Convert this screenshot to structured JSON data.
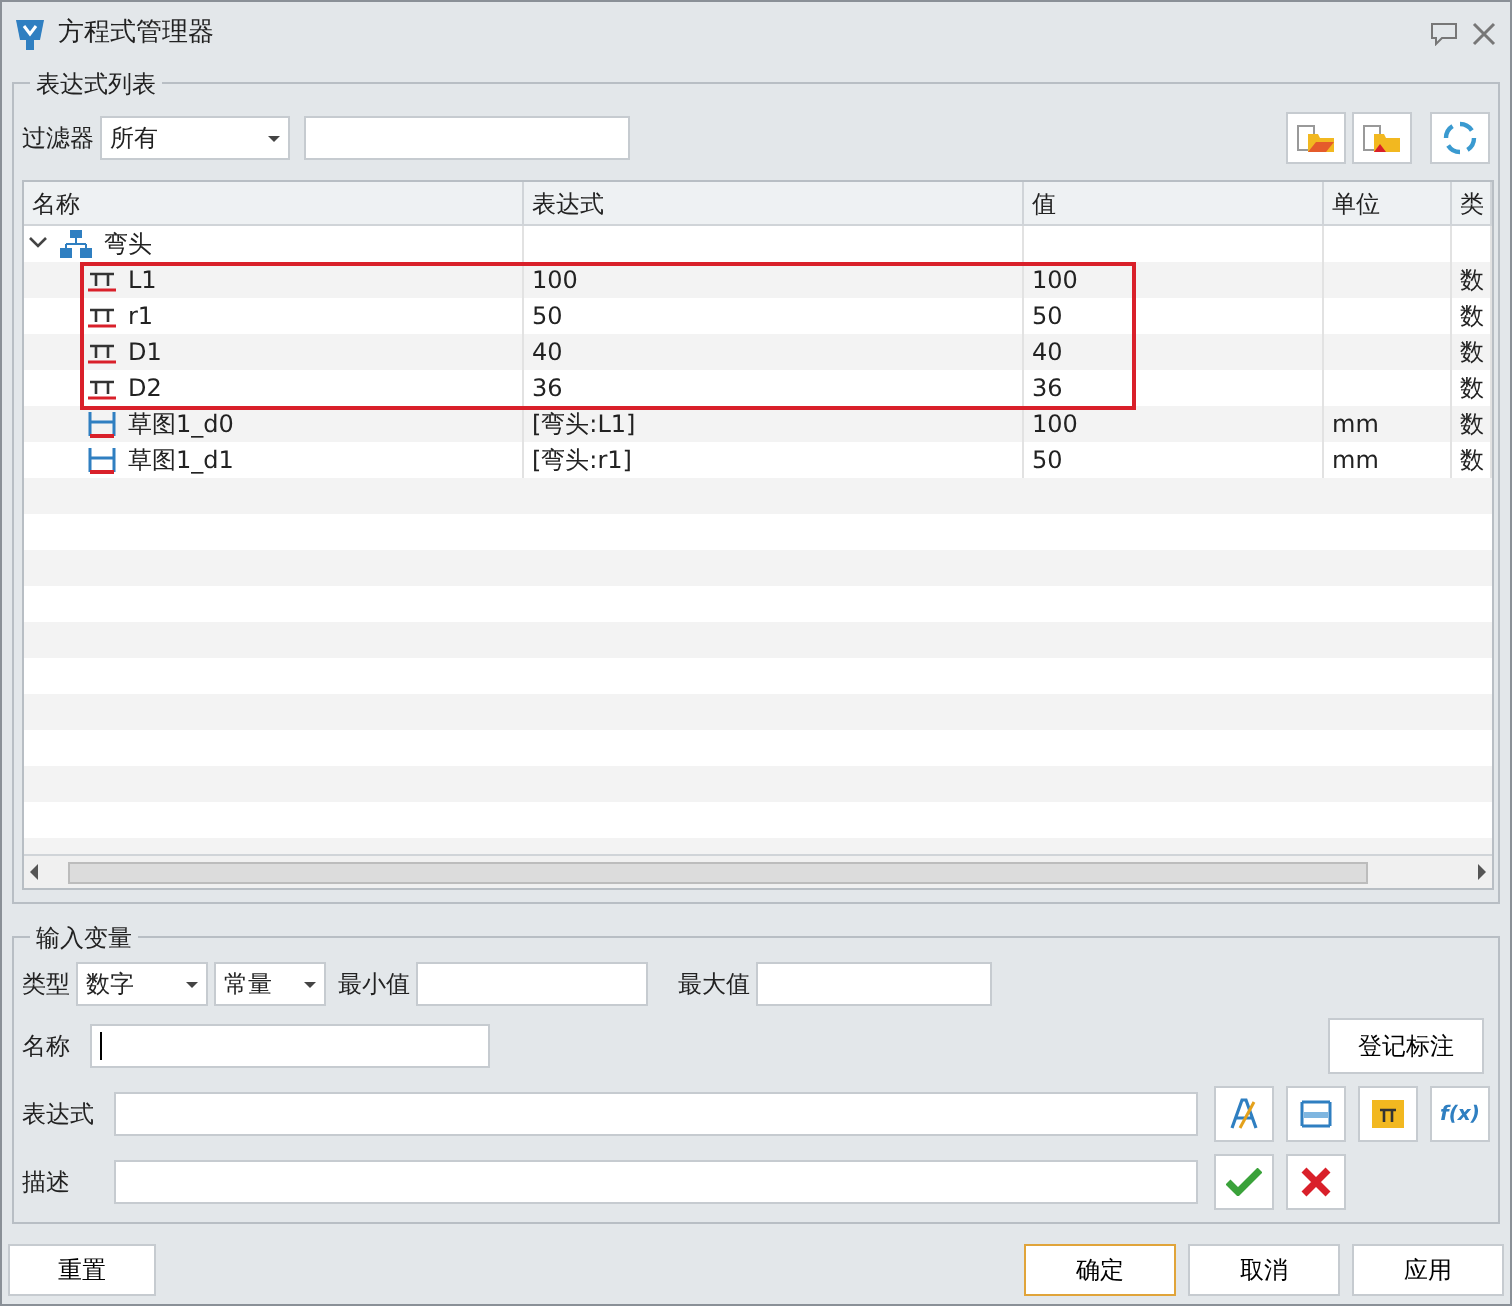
{
  "window": {
    "title": "方程式管理器"
  },
  "expression_list": {
    "legend": "表达式列表",
    "filter_label": "过滤器",
    "filter_value": "所有",
    "toolbar": [
      {
        "kind": "import"
      },
      {
        "kind": "export"
      },
      {
        "kind": "refresh"
      }
    ],
    "columns": [
      "名称",
      "表达式",
      "值",
      "单位",
      "类"
    ],
    "nodes": [
      {
        "name": "弯头",
        "kind": "assembly",
        "expanded": true,
        "children": [
          {
            "name": "L1",
            "kind": "constant",
            "expression": "100",
            "value": "100",
            "type": "数",
            "highlighted": true
          },
          {
            "name": "r1",
            "kind": "constant",
            "expression": "50",
            "value": "50",
            "type": "数",
            "highlighted": true
          },
          {
            "name": "D1",
            "kind": "constant",
            "expression": "40",
            "value": "40",
            "type": "数",
            "highlighted": true
          },
          {
            "name": "D2",
            "kind": "constant",
            "expression": "36",
            "value": "36",
            "type": "数",
            "highlighted": true
          },
          {
            "name": "草图1_d0",
            "kind": "dimension",
            "expression": "[弯头:L1]",
            "value": "100",
            "unit": "mm",
            "type": "数",
            "highlighted": false
          },
          {
            "name": "草图1_d1",
            "kind": "dimension",
            "expression": "[弯头:r1]",
            "value": "50",
            "unit": "mm",
            "type": "数",
            "highlighted": false
          }
        ]
      }
    ]
  },
  "input_variable": {
    "legend": "输入变量",
    "type_label": "类型",
    "type_value": "数字",
    "mode_value": "常量",
    "min_label": "最小值",
    "max_label": "最大值",
    "name_label": "名称",
    "register_button": "登记标注",
    "expression_label": "表达式",
    "description_label": "描述",
    "expression_tools": [
      {
        "kind": "text"
      },
      {
        "kind": "dimension"
      },
      {
        "kind": "constant"
      },
      {
        "kind": "function",
        "label": "f(x)"
      }
    ],
    "confirm_tools": [
      {
        "kind": "accept"
      },
      {
        "kind": "cancel"
      }
    ]
  },
  "footer": [
    {
      "label": "重置",
      "default": false
    },
    {
      "label": "确定",
      "default": true
    },
    {
      "label": "取消",
      "default": false
    },
    {
      "label": "应用",
      "default": false
    }
  ]
}
